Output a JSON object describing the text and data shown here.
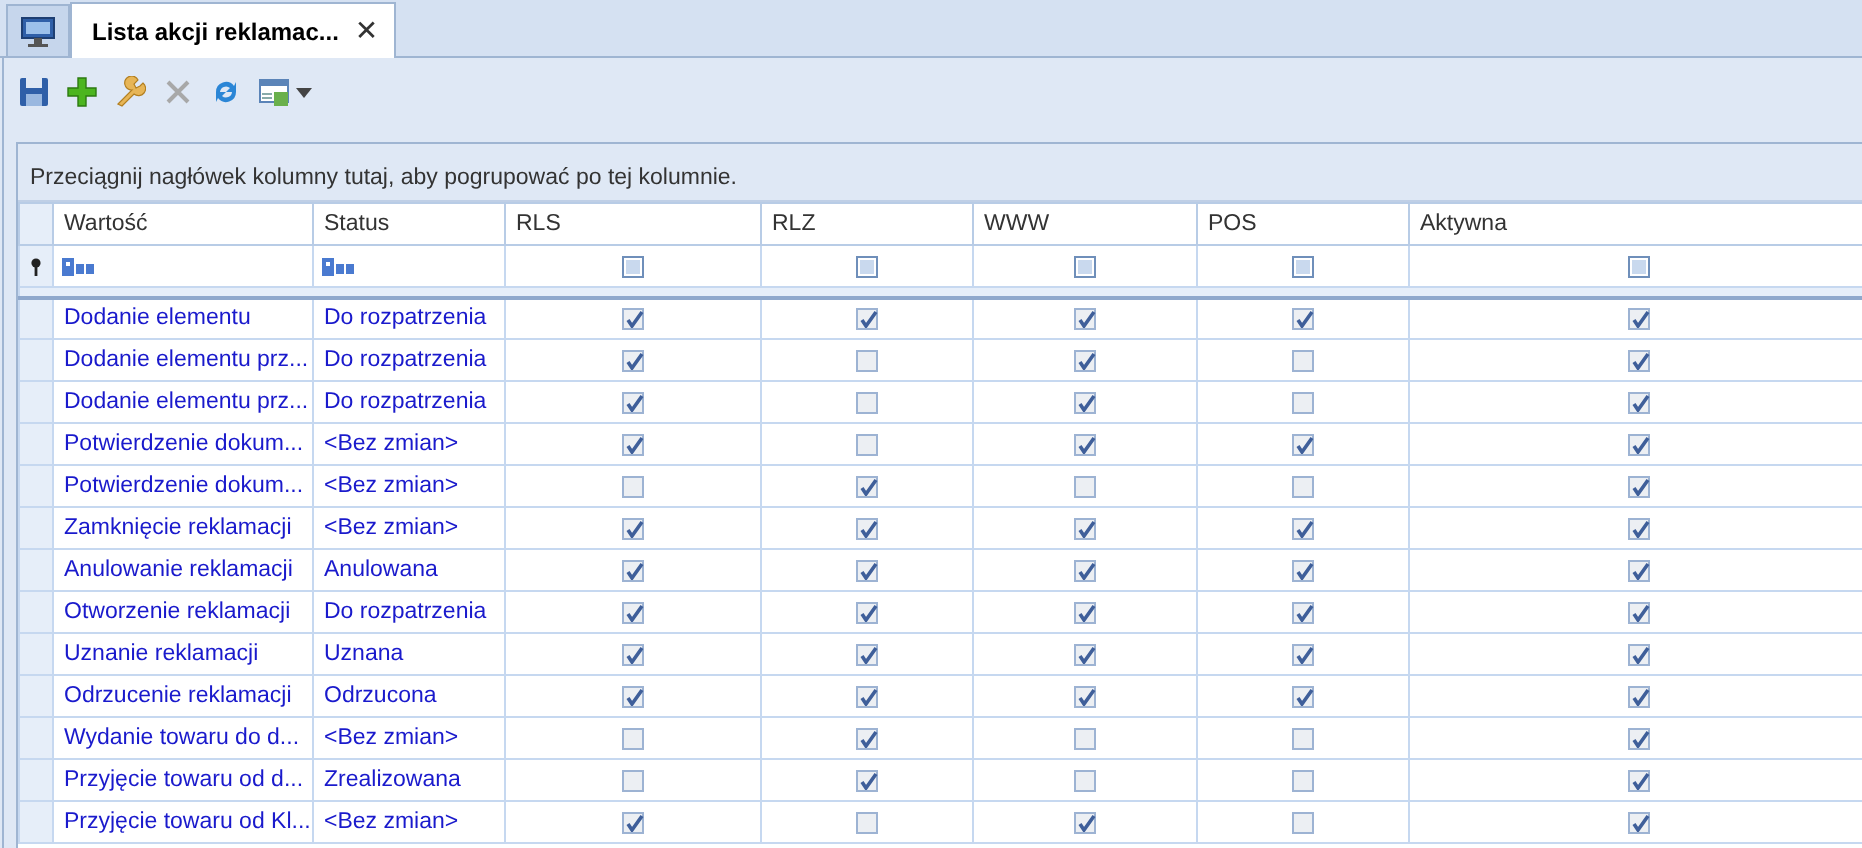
{
  "tabs": [
    {
      "kind": "home",
      "selected": false
    },
    {
      "kind": "document",
      "label": "Lista akcji reklamac...",
      "close": "✕",
      "selected": true
    }
  ],
  "toolbar": [
    {
      "kind": "save",
      "disabled": false
    },
    {
      "kind": "add",
      "disabled": false
    },
    {
      "kind": "edit",
      "disabled": false
    },
    {
      "kind": "delete",
      "disabled": true
    },
    {
      "kind": "refresh",
      "disabled": false
    },
    {
      "kind": "export",
      "disabled": false,
      "dropdown": true
    }
  ],
  "group_panel": {
    "hint": "Przeciągnij nagłówek kolumny tutaj, aby pogrupować po tej kolumnie."
  },
  "table": {
    "columns": [
      {
        "label": "Wartość",
        "kind": "text"
      },
      {
        "label": "Status",
        "kind": "text"
      },
      {
        "label": "RLS",
        "kind": "check",
        "filter_indeterminate": true
      },
      {
        "label": "RLZ",
        "kind": "check",
        "filter_indeterminate": true
      },
      {
        "label": "WWW",
        "kind": "check",
        "filter_indeterminate": true
      },
      {
        "label": "POS",
        "kind": "check",
        "filter_indeterminate": true
      },
      {
        "label": "Aktywna",
        "kind": "check",
        "filter_indeterminate": true
      }
    ],
    "rows": [
      {
        "cells": [
          "Dodanie elementu",
          "Do rozpatrzenia",
          true,
          true,
          true,
          true,
          true
        ]
      },
      {
        "cells": [
          "Dodanie elementu prz...",
          "Do rozpatrzenia",
          true,
          false,
          true,
          false,
          true
        ]
      },
      {
        "cells": [
          "Dodanie elementu prz...",
          "Do rozpatrzenia",
          true,
          false,
          true,
          false,
          true
        ]
      },
      {
        "cells": [
          "Potwierdzenie dokum...",
          "<Bez zmian>",
          true,
          false,
          true,
          true,
          true
        ]
      },
      {
        "cells": [
          "Potwierdzenie dokum...",
          "<Bez zmian>",
          false,
          true,
          false,
          false,
          true
        ]
      },
      {
        "cells": [
          "Zamknięcie reklamacji",
          "<Bez zmian>",
          true,
          true,
          true,
          true,
          true
        ]
      },
      {
        "cells": [
          "Anulowanie reklamacji",
          "Anulowana",
          true,
          true,
          true,
          true,
          true
        ]
      },
      {
        "cells": [
          "Otworzenie reklamacji",
          "Do rozpatrzenia",
          true,
          true,
          true,
          true,
          true
        ]
      },
      {
        "cells": [
          "Uznanie reklamacji",
          "Uznana",
          true,
          true,
          true,
          true,
          true
        ]
      },
      {
        "cells": [
          "Odrzucenie reklamacji",
          "Odrzucona",
          true,
          true,
          true,
          true,
          true
        ]
      },
      {
        "cells": [
          "Wydanie towaru do d...",
          "<Bez zmian>",
          false,
          true,
          false,
          false,
          true
        ]
      },
      {
        "cells": [
          "Przyjęcie towaru od d...",
          "Zrealizowana",
          false,
          true,
          false,
          false,
          true
        ]
      },
      {
        "cells": [
          "Przyjęcie towaru od Kl...",
          "<Bez zmian>",
          true,
          false,
          true,
          false,
          true
        ]
      }
    ]
  }
}
